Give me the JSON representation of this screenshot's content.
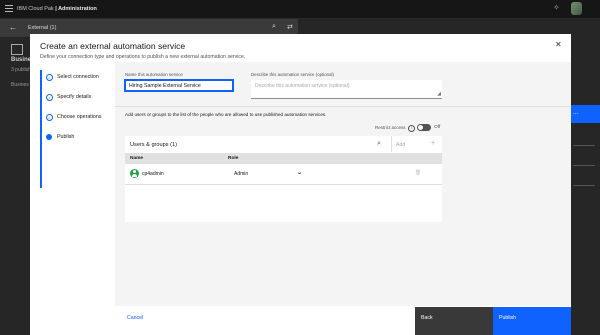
{
  "topbar": {
    "brand_prefix": "IBM Cloud Pak",
    "brand_suffix": " | Administration"
  },
  "background": {
    "subheader_title": "External (1)",
    "left_title": "Busine",
    "left_sub": "3 publish",
    "left_bottom": "Busines",
    "right_button": "..."
  },
  "modal": {
    "title": "Create an external automation service",
    "description": "Define your connection type and operations to publish a new external automation service.",
    "steps": [
      {
        "label": "Select connection",
        "state": "complete"
      },
      {
        "label": "Specify details",
        "state": "complete"
      },
      {
        "label": "Choose operations",
        "state": "complete"
      },
      {
        "label": "Publish",
        "state": "current"
      }
    ],
    "form": {
      "name_label": "Name this automation service",
      "name_value": "Hiring Sample External Service",
      "desc_label": "Describe this automation service (optional)",
      "desc_placeholder": "Describe this automation service (optional)",
      "help_text": "Add users or groups to the list of the people who are allowed to use published automation services.",
      "restrict_label": "Restrict access",
      "toggle_state": "Off"
    },
    "table": {
      "title": "Users & groups (1)",
      "add_placeholder": "Add",
      "columns": [
        "Name",
        "Role"
      ],
      "rows": [
        {
          "name": "cp4admin",
          "role": "Admin"
        }
      ]
    },
    "footer": {
      "cancel": "Cancel",
      "back": "Back",
      "publish": "Publish"
    }
  },
  "colors": {
    "accent": "#0f62fe",
    "avatar": "#24a148"
  }
}
